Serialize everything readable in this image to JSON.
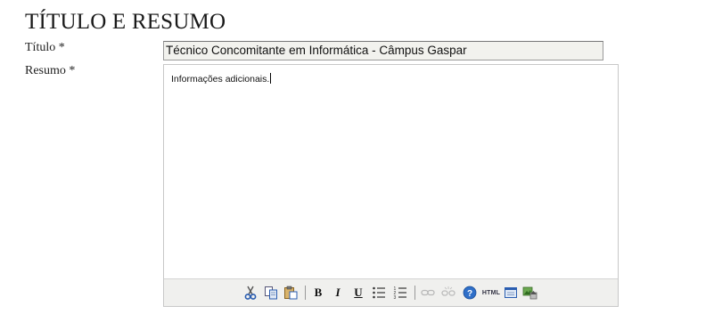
{
  "section": {
    "title": "TÍTULO E RESUMO"
  },
  "form": {
    "title_label": "Título *",
    "title_value": "Técnico Concomitante em Informática - Câmpus Gaspar",
    "summary_label": "Resumo *",
    "summary_value": "Informações adicionais."
  },
  "toolbar": {
    "bold": "B",
    "italic": "I",
    "underline": "U",
    "html": "HTML"
  },
  "colors": {
    "toolbar_bg": "#f0f0ee",
    "input_bg": "#f2f2ee",
    "help_blue": "#2f6fc8"
  }
}
